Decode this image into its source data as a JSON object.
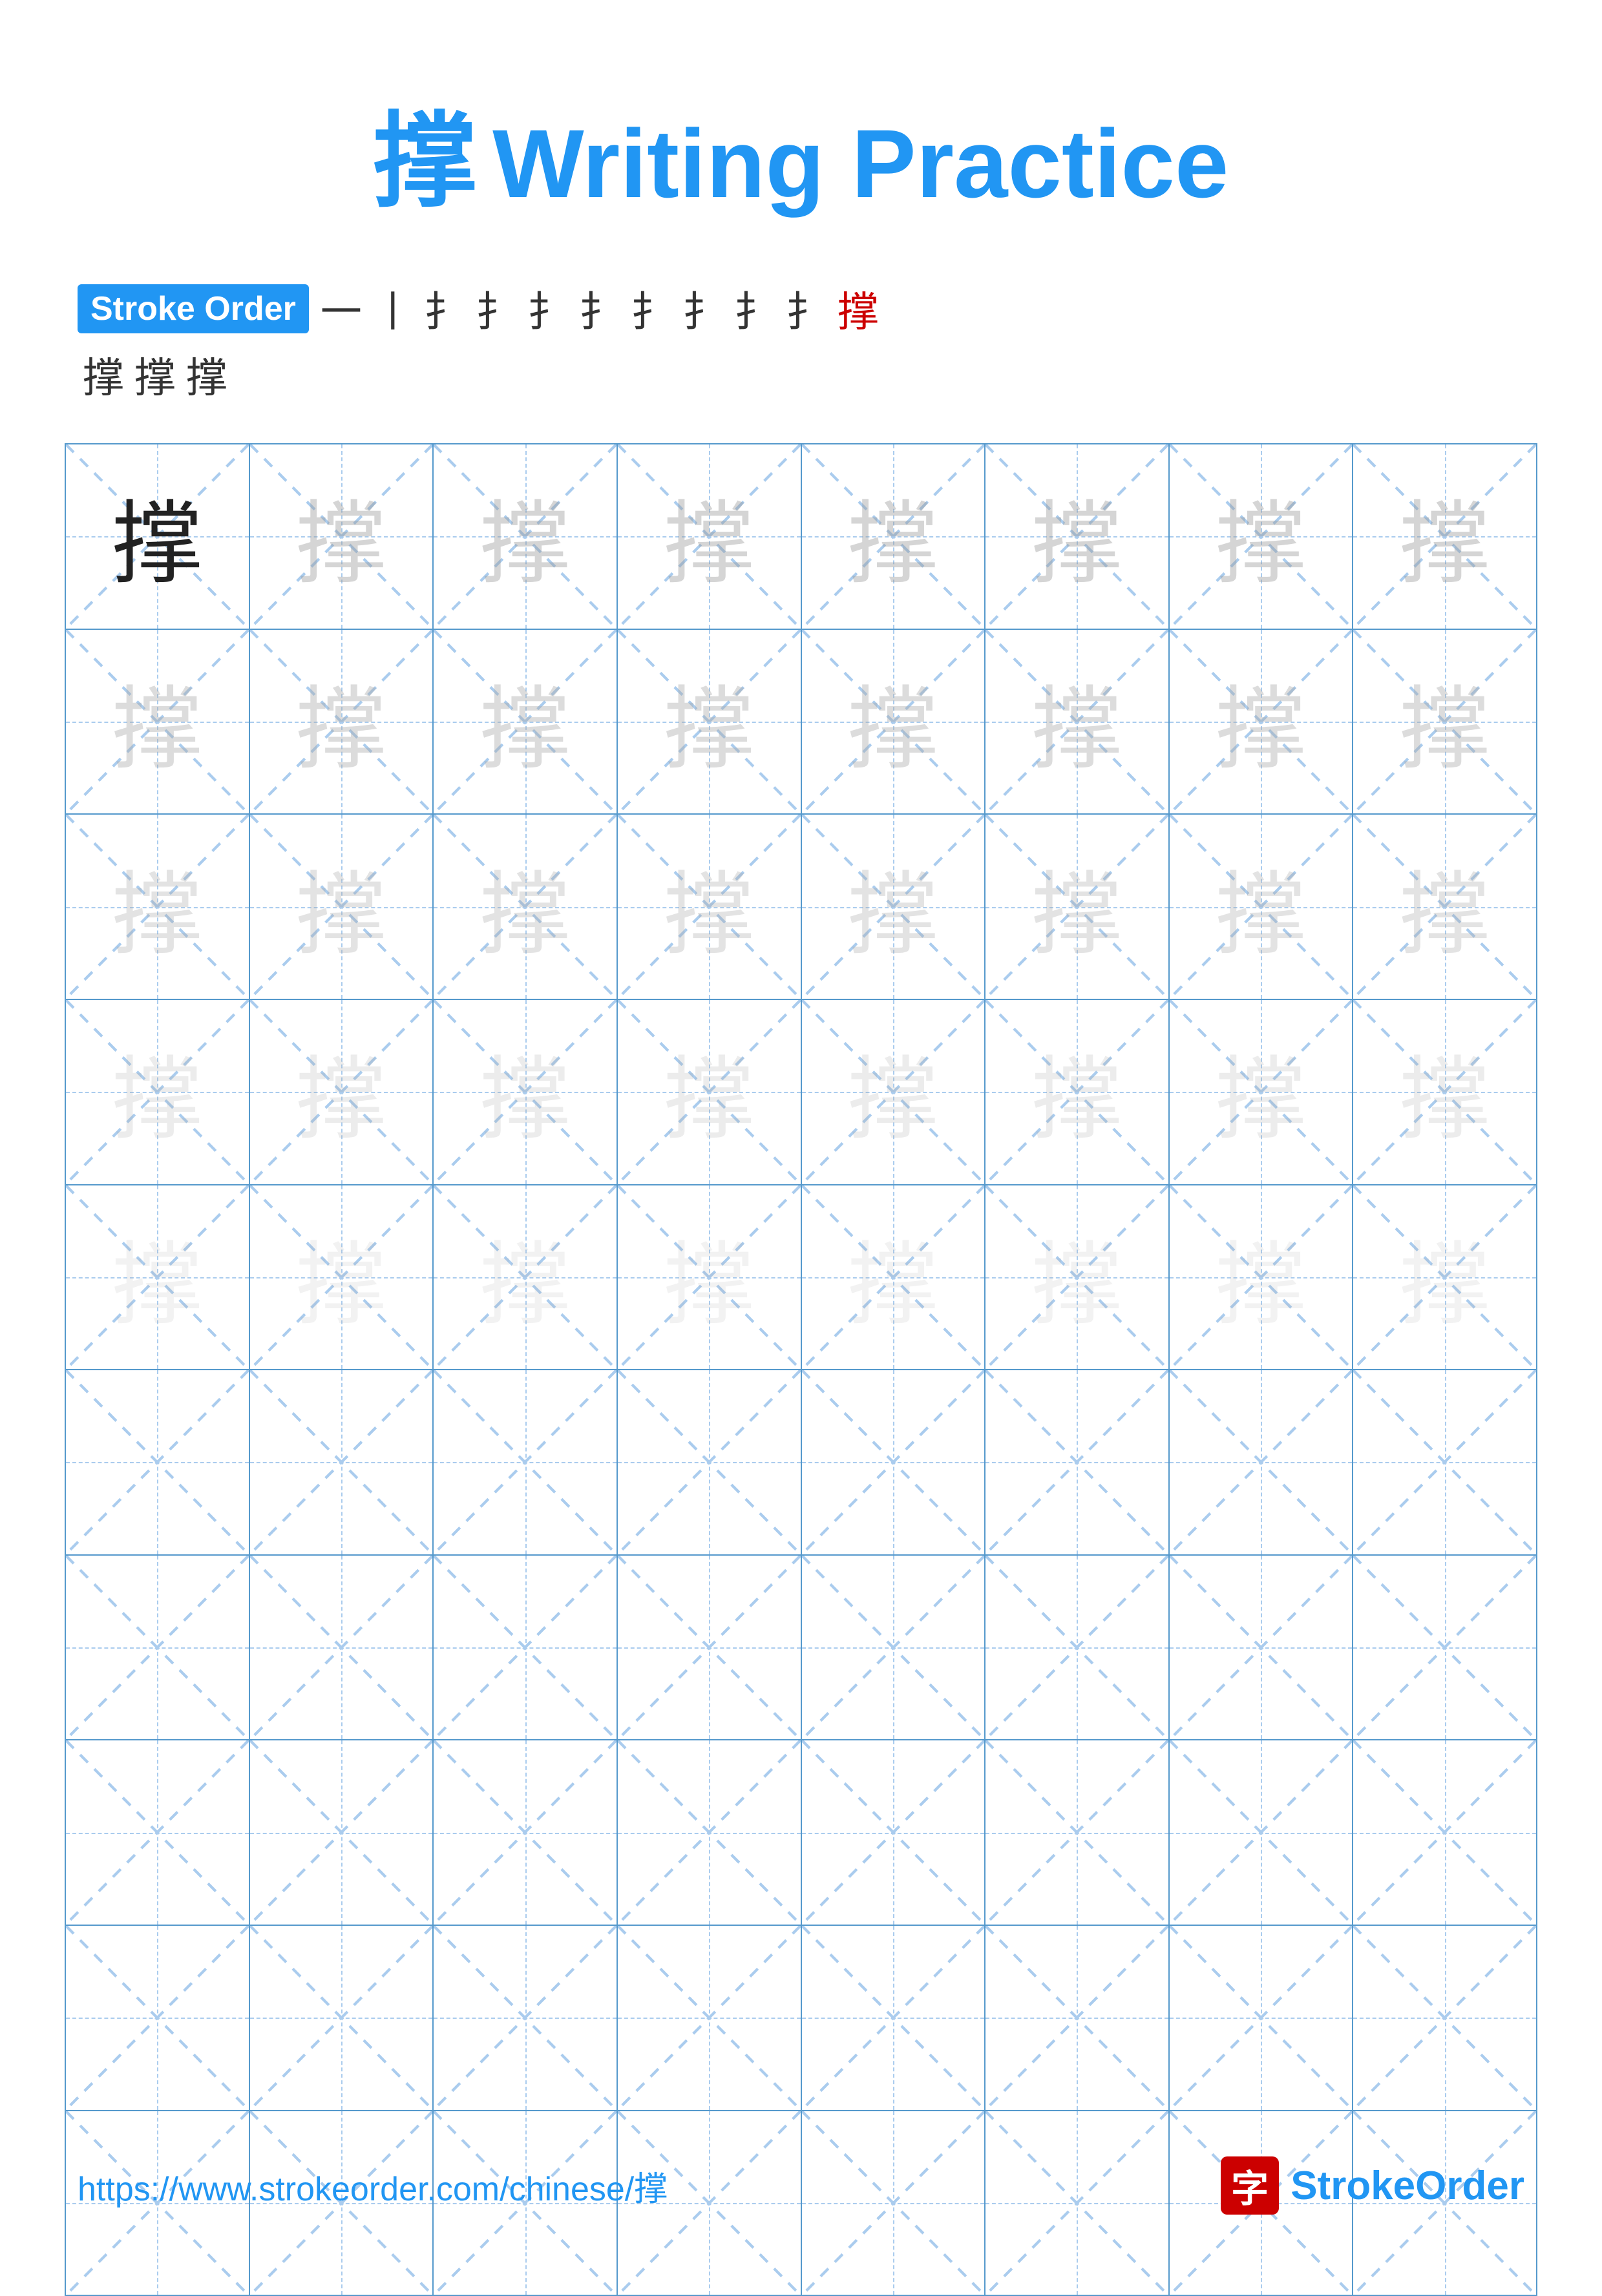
{
  "title": {
    "char": "撑",
    "text": "Writing Practice"
  },
  "stroke_order": {
    "badge": "Stroke Order",
    "chars_row1": [
      "⼀",
      "丨",
      "扌",
      "扌'",
      "扌⁺",
      "扌⁺'",
      "扌⁺+",
      "扌++",
      "扌+++",
      "扌++++",
      "撑"
    ],
    "chars_row2": [
      "撑",
      "撑",
      "撑"
    ],
    "display_row1": "— 丨 扌 扌 扌 扌 扌 扌 扌 扌 撑",
    "display_row2": "撑 撑 撑"
  },
  "practice_char": "撑",
  "rows": 10,
  "cols": 8,
  "footer": {
    "url": "https://www.strokeorder.com/chinese/撑",
    "logo_char": "字",
    "logo_text_stroke": "Stroke",
    "logo_text_order": "Order"
  }
}
